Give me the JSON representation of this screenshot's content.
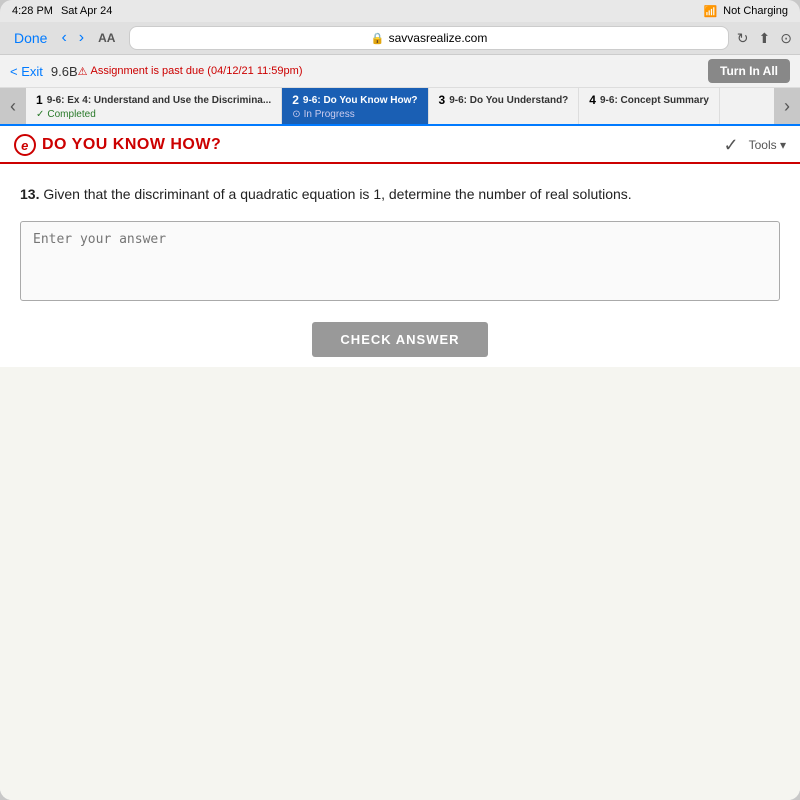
{
  "status_bar": {
    "time": "4:28 PM",
    "day": "Sat Apr 24",
    "wifi": "Not Charging"
  },
  "browser": {
    "done_label": "Done",
    "back_arrow": "‹",
    "forward_arrow": "›",
    "aa_label": "AA",
    "url": "savvasrealize.com",
    "reload_icon": "↻",
    "share_icon": "⬆",
    "bookmark_icon": "⊙"
  },
  "app_toolbar": {
    "exit_label": "< Exit",
    "section_code": "9.6B",
    "assignment_notice": "Assignment is past due (04/12/21 11:59pm)",
    "turn_in_label": "Turn In All"
  },
  "steps": [
    {
      "number": "1",
      "title": "9-6: Ex 4: Understand and Use the Discrimina...",
      "status": "Completed",
      "status_type": "completed"
    },
    {
      "number": "2",
      "title": "9-6: Do You Know How?",
      "status": "In Progress",
      "status_type": "in-progress"
    },
    {
      "number": "3",
      "title": "9-6: Do You Understand?",
      "status": "",
      "status_type": ""
    },
    {
      "number": "4",
      "title": "9-6: Concept Summary",
      "status": "",
      "status_type": ""
    }
  ],
  "section": {
    "logo": "e",
    "title": "DO YOU KNOW HOW?",
    "tools_label": "Tools ▾"
  },
  "question": {
    "number": "13",
    "text": "Given that the discriminant of a quadratic equation is 1, determine the number of real solutions.",
    "input_placeholder": "Enter your answer",
    "check_answer_label": "CHECK ANSWER"
  }
}
